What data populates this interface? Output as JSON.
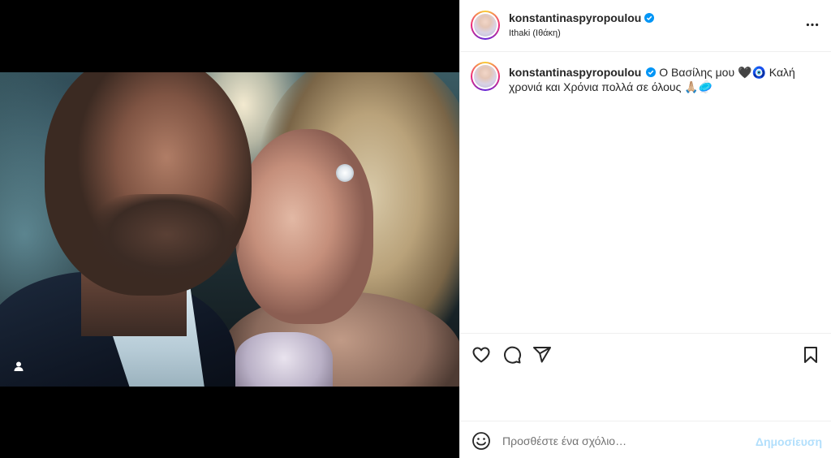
{
  "post": {
    "username": "konstantinaspyropoulou",
    "location": "Ithaki (Ιθάκη)",
    "verified": true
  },
  "caption": {
    "username": "konstantinaspyropoulou",
    "text": "Ο Βασίλης μου 🖤🧿 Καλή χρονιά και Χρόνια πολλά σε όλους 🙏🏼🥏"
  },
  "media": {
    "description_icon": "tagged-user-icon"
  },
  "actions": {
    "icons": [
      "heart-icon",
      "comment-icon",
      "share-icon",
      "bookmark-icon"
    ]
  },
  "comment_box": {
    "placeholder": "Προσθέστε ένα σχόλιο…",
    "post_label": "Δημοσίευση"
  },
  "colors": {
    "verified": "#0095f6",
    "post_button_disabled": "#b2dffc",
    "story_ring": "#ee2a7b"
  }
}
